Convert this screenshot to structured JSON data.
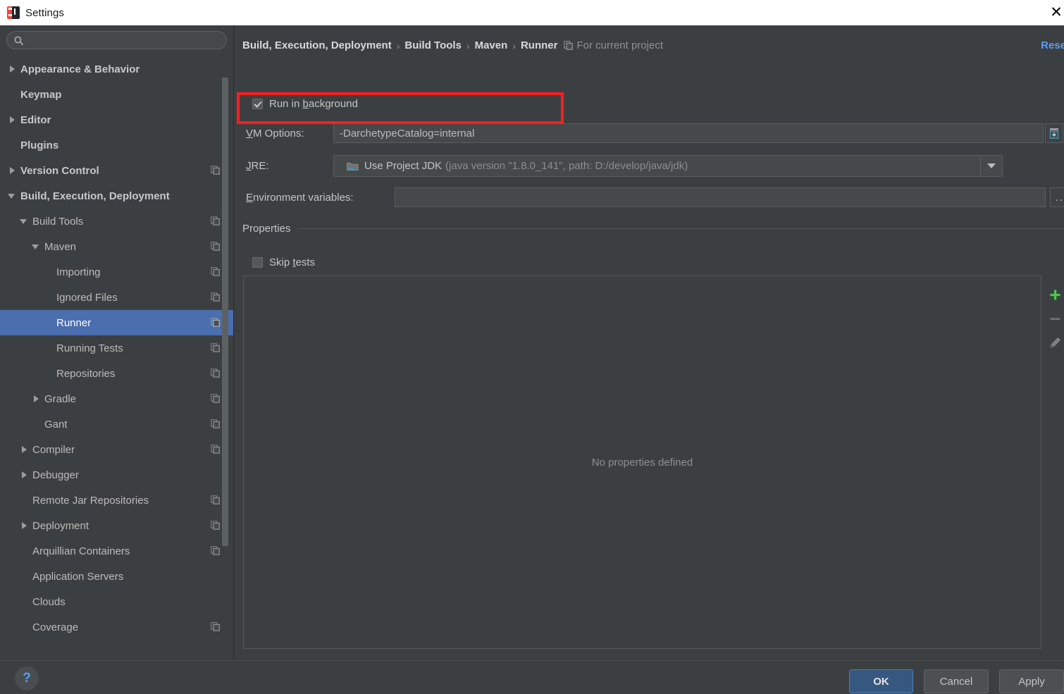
{
  "window": {
    "title": "Settings",
    "app_icon": "intellij-idea-icon",
    "close_icon": "close-icon"
  },
  "sidebar": {
    "search": {
      "value": "",
      "placeholder": "",
      "icon": "search-icon"
    },
    "items": [
      {
        "label": "Appearance & Behavior",
        "indent": 0,
        "arrow": "collapsed",
        "bold": true,
        "copy": false,
        "selected": false
      },
      {
        "label": "Keymap",
        "indent": 0,
        "arrow": "none",
        "bold": true,
        "copy": false,
        "selected": false
      },
      {
        "label": "Editor",
        "indent": 0,
        "arrow": "collapsed",
        "bold": true,
        "copy": false,
        "selected": false
      },
      {
        "label": "Plugins",
        "indent": 0,
        "arrow": "none",
        "bold": true,
        "copy": false,
        "selected": false
      },
      {
        "label": "Version Control",
        "indent": 0,
        "arrow": "collapsed",
        "bold": true,
        "copy": true,
        "selected": false
      },
      {
        "label": "Build, Execution, Deployment",
        "indent": 0,
        "arrow": "expanded",
        "bold": true,
        "copy": false,
        "selected": false
      },
      {
        "label": "Build Tools",
        "indent": 1,
        "arrow": "expanded",
        "bold": false,
        "copy": true,
        "selected": false
      },
      {
        "label": "Maven",
        "indent": 2,
        "arrow": "expanded",
        "bold": false,
        "copy": true,
        "selected": false
      },
      {
        "label": "Importing",
        "indent": 3,
        "arrow": "none",
        "bold": false,
        "copy": true,
        "selected": false
      },
      {
        "label": "Ignored Files",
        "indent": 3,
        "arrow": "none",
        "bold": false,
        "copy": true,
        "selected": false
      },
      {
        "label": "Runner",
        "indent": 3,
        "arrow": "none",
        "bold": false,
        "copy": true,
        "selected": true
      },
      {
        "label": "Running Tests",
        "indent": 3,
        "arrow": "none",
        "bold": false,
        "copy": true,
        "selected": false
      },
      {
        "label": "Repositories",
        "indent": 3,
        "arrow": "none",
        "bold": false,
        "copy": true,
        "selected": false
      },
      {
        "label": "Gradle",
        "indent": 2,
        "arrow": "collapsed",
        "bold": false,
        "copy": true,
        "selected": false
      },
      {
        "label": "Gant",
        "indent": 2,
        "arrow": "none",
        "bold": false,
        "copy": true,
        "selected": false
      },
      {
        "label": "Compiler",
        "indent": 1,
        "arrow": "collapsed",
        "bold": false,
        "copy": true,
        "selected": false
      },
      {
        "label": "Debugger",
        "indent": 1,
        "arrow": "collapsed",
        "bold": false,
        "copy": false,
        "selected": false
      },
      {
        "label": "Remote Jar Repositories",
        "indent": 1,
        "arrow": "none",
        "bold": false,
        "copy": true,
        "selected": false
      },
      {
        "label": "Deployment",
        "indent": 1,
        "arrow": "collapsed",
        "bold": false,
        "copy": true,
        "selected": false
      },
      {
        "label": "Arquillian Containers",
        "indent": 1,
        "arrow": "none",
        "bold": false,
        "copy": true,
        "selected": false
      },
      {
        "label": "Application Servers",
        "indent": 1,
        "arrow": "none",
        "bold": false,
        "copy": false,
        "selected": false
      },
      {
        "label": "Clouds",
        "indent": 1,
        "arrow": "none",
        "bold": false,
        "copy": false,
        "selected": false
      },
      {
        "label": "Coverage",
        "indent": 1,
        "arrow": "none",
        "bold": false,
        "copy": true,
        "selected": false
      }
    ]
  },
  "header": {
    "crumbs": [
      "Build, Execution, Deployment",
      "Build Tools",
      "Maven",
      "Runner"
    ],
    "separator": "›",
    "scope_icon": "project-scope-icon",
    "scope_text": "For current project",
    "reset_label": "Reset"
  },
  "form": {
    "run_in_background": {
      "label_pre": "Run in ",
      "label_mnemonic": "b",
      "label_post": "ackground",
      "checked": true
    },
    "vm_options": {
      "label_mnemonic": "V",
      "label_post": "M Options:",
      "value": "-DarchetypeCatalog=internal",
      "expand_icon": "expand-field-icon"
    },
    "jre": {
      "label_mnemonic": "J",
      "label_post": "RE:",
      "icon": "folder-icon",
      "value": "Use Project JDK",
      "detail": "(java version \"1.8.0_141\", path: D:/develop/java/jdk)",
      "arrow_icon": "chevron-down-icon"
    },
    "environment_variables": {
      "label_mnemonic": "E",
      "label_post": "nvironment variables:",
      "value": "",
      "browse_label": "..."
    },
    "properties_section": {
      "title": "Properties",
      "skip_tests": {
        "label_pre": "Skip ",
        "label_mnemonic": "t",
        "label_post": "ests",
        "checked": false
      },
      "empty_text": "No properties defined",
      "toolbar": [
        {
          "icon": "plus-icon",
          "name": "add-property-button"
        },
        {
          "icon": "minus-icon",
          "name": "remove-property-button"
        },
        {
          "icon": "pencil-icon",
          "name": "edit-property-button"
        }
      ]
    }
  },
  "footer": {
    "help_label": "?",
    "ok_label": "OK",
    "cancel_label": "Cancel",
    "apply_label": "Apply"
  },
  "annotation": {
    "color": "#ff1d1d",
    "target": "vm-options-row"
  }
}
